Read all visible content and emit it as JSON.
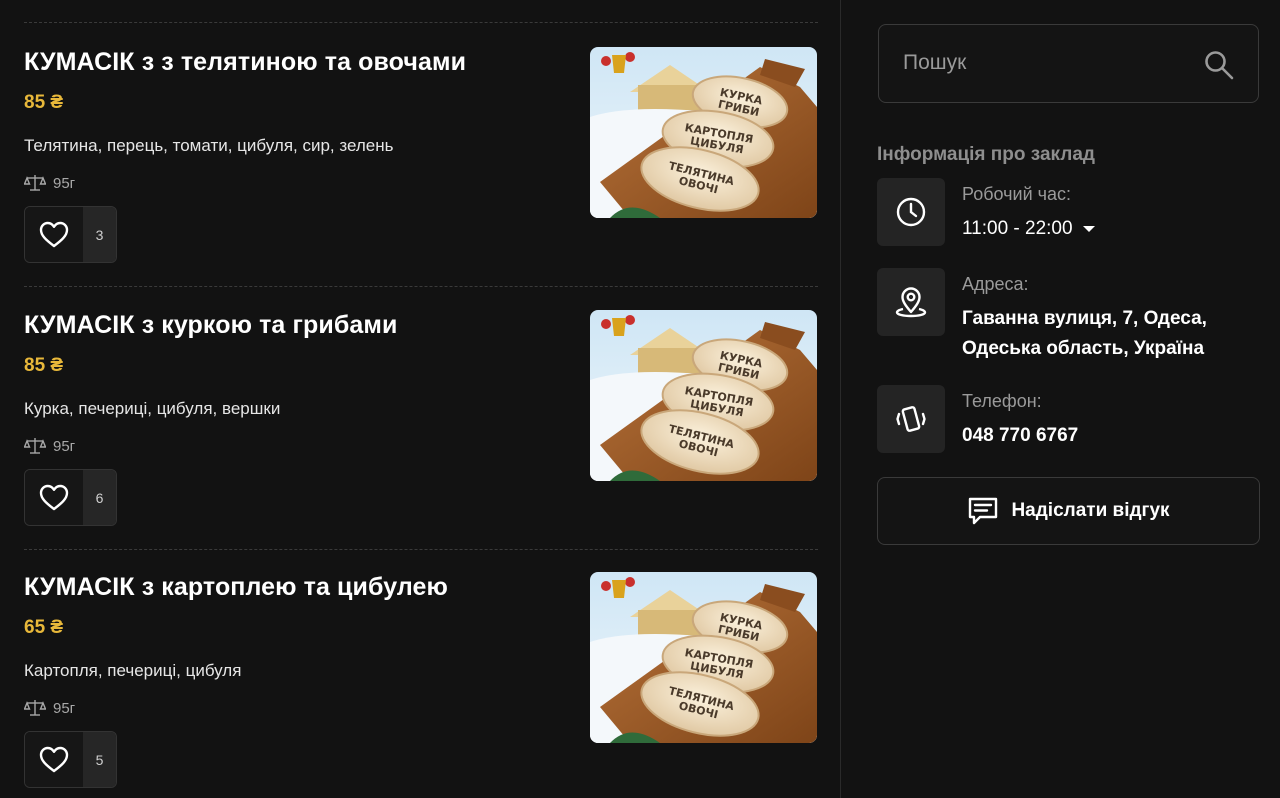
{
  "menu": {
    "items": [
      {
        "title": "КУМАСІК з з телятиною та овочами",
        "price": "85 ₴",
        "description": "Телятина, перець, томати, цибуля, сир, зелень",
        "weight": "95г",
        "likes": "3",
        "image": "dumplings-photo"
      },
      {
        "title": "КУМАСІК з куркою та грибами",
        "price": "85 ₴",
        "description": "Курка, печериці, цибуля, вершки",
        "weight": "95г",
        "likes": "6",
        "image": "dumplings-photo"
      },
      {
        "title": "КУМАСІК з картоплею та цибулею",
        "price": "65 ₴",
        "description": "Картопля, печериці, цибуля",
        "weight": "95г",
        "likes": "5",
        "image": "dumplings-photo"
      }
    ],
    "image_stamps": [
      "КУРКА ГРИБИ",
      "КАРТОПЛЯ ЦИБУЛЯ",
      "ТЕЛЯТИНА ОВОЧІ"
    ]
  },
  "search": {
    "placeholder": "Пошук",
    "icon": "search-icon"
  },
  "info": {
    "title": "Інформація про заклад",
    "hours": {
      "label": "Робочий час:",
      "value": "11:00 - 22:00",
      "icon": "clock-icon"
    },
    "address": {
      "label": "Адреса:",
      "line1": "Гаванна вулиця, 7, Одеса,",
      "line2": "Одеська область, Україна",
      "icon": "map-pin-icon"
    },
    "phone": {
      "label": "Телефон:",
      "value": "048 770 6767",
      "icon": "phone-vibrate-icon"
    }
  },
  "feedback": {
    "label": "Надіслати відгук",
    "icon": "message-icon"
  },
  "colors": {
    "background": "#121212",
    "price": "#e8b83a",
    "panel": "#242424"
  }
}
